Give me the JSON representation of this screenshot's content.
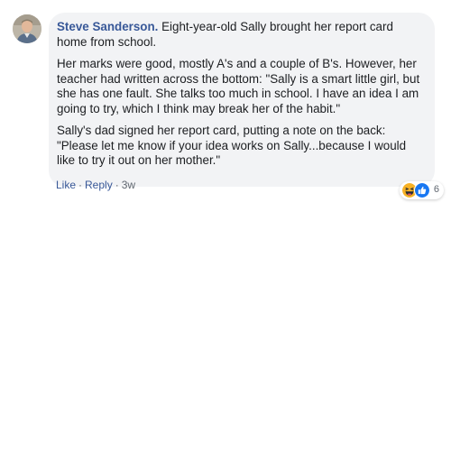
{
  "comment": {
    "author": "Steve Sanderson.",
    "paragraphs": [
      "Eight-year-old Sally brought her report card home from school.",
      "Her marks were good, mostly A's and a couple of B's. However, her teacher had written across the bottom: \"Sally is a smart little girl, but she has one fault. She talks too much in school. I have an idea I am going to try, which I think may break her of the habit.\"",
      "Sally's dad signed her report card, putting a note on the back: \"Please let me know if your idea works on Sally...because I would like to try it out on her mother.\""
    ],
    "reactions": {
      "icons": [
        "haha-icon",
        "like-icon"
      ],
      "count": "6"
    },
    "actions": {
      "like_label": "Like",
      "reply_label": "Reply",
      "separator": "·",
      "timestamp": "3w"
    }
  },
  "colors": {
    "author": "#385898",
    "bubble": "#f2f3f5",
    "text": "#1c1e21",
    "meta": "#606770",
    "like_blue": "#1877f2",
    "haha_yellow": "#f7b125"
  }
}
